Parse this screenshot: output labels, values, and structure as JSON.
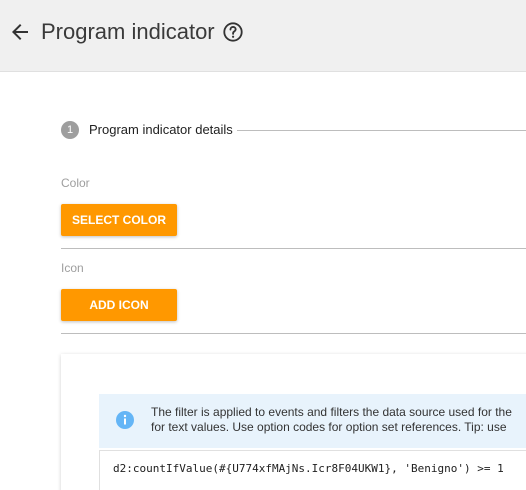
{
  "header": {
    "title": "Program indicator",
    "back_icon": "arrow-back-icon",
    "help_icon": "help-circle-icon"
  },
  "stepper": {
    "step_number": "1",
    "step_label": "Program indicator details"
  },
  "form": {
    "color_label": "Color",
    "select_color_button": "SELECT COLOR",
    "icon_label": "Icon",
    "add_icon_button": "ADD ICON"
  },
  "filter_info": {
    "line1": "The filter is applied to events and filters the data source used for the",
    "line2": "for text values. Use option codes for option set references. Tip: use",
    "icon": "info-icon"
  },
  "filter_expression": "d2:countIfValue(#{U774xfMAjNs.Icr8F04UKW1}, 'Benigno') >= 1",
  "colors": {
    "accent": "#ff9800",
    "header_bg": "#f0f0f0",
    "info_bg": "#e8f3fc",
    "info_icon": "#64b5f6"
  }
}
